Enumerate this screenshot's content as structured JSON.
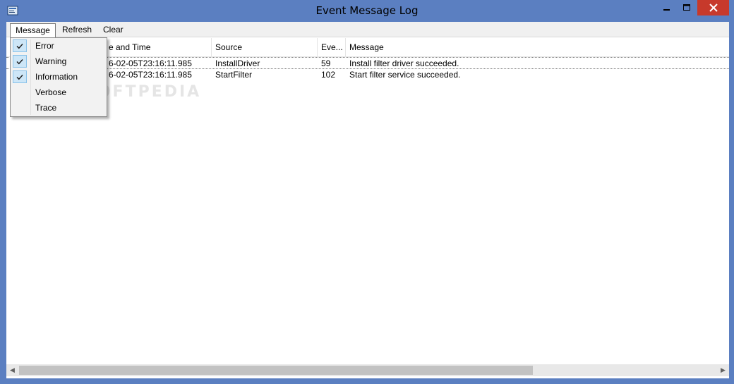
{
  "window": {
    "title": "Event Message Log"
  },
  "menu": {
    "message": "Message",
    "refresh": "Refresh",
    "clear": "Clear"
  },
  "dropdown": {
    "items": [
      {
        "label": "Error",
        "checked": true
      },
      {
        "label": "Warning",
        "checked": true
      },
      {
        "label": "Information",
        "checked": true
      },
      {
        "label": "Verbose",
        "checked": false
      },
      {
        "label": "Trace",
        "checked": false
      }
    ]
  },
  "table": {
    "columns": [
      "e and Time",
      "Source",
      "Eve...",
      "Message"
    ],
    "rows": [
      {
        "datetime": "6-02-05T23:16:11.985",
        "source": "InstallDriver",
        "event": "59",
        "message": "Install filter driver succeeded."
      },
      {
        "datetime": "6-02-05T23:16:11.985",
        "source": "StartFilter",
        "event": "102",
        "message": "Start filter service succeeded."
      }
    ]
  },
  "watermark": "SOFTPEDIA",
  "colors": {
    "titlebar": "#5b7fc1",
    "close": "#c7392b",
    "check_bg": "#cde6f7"
  }
}
